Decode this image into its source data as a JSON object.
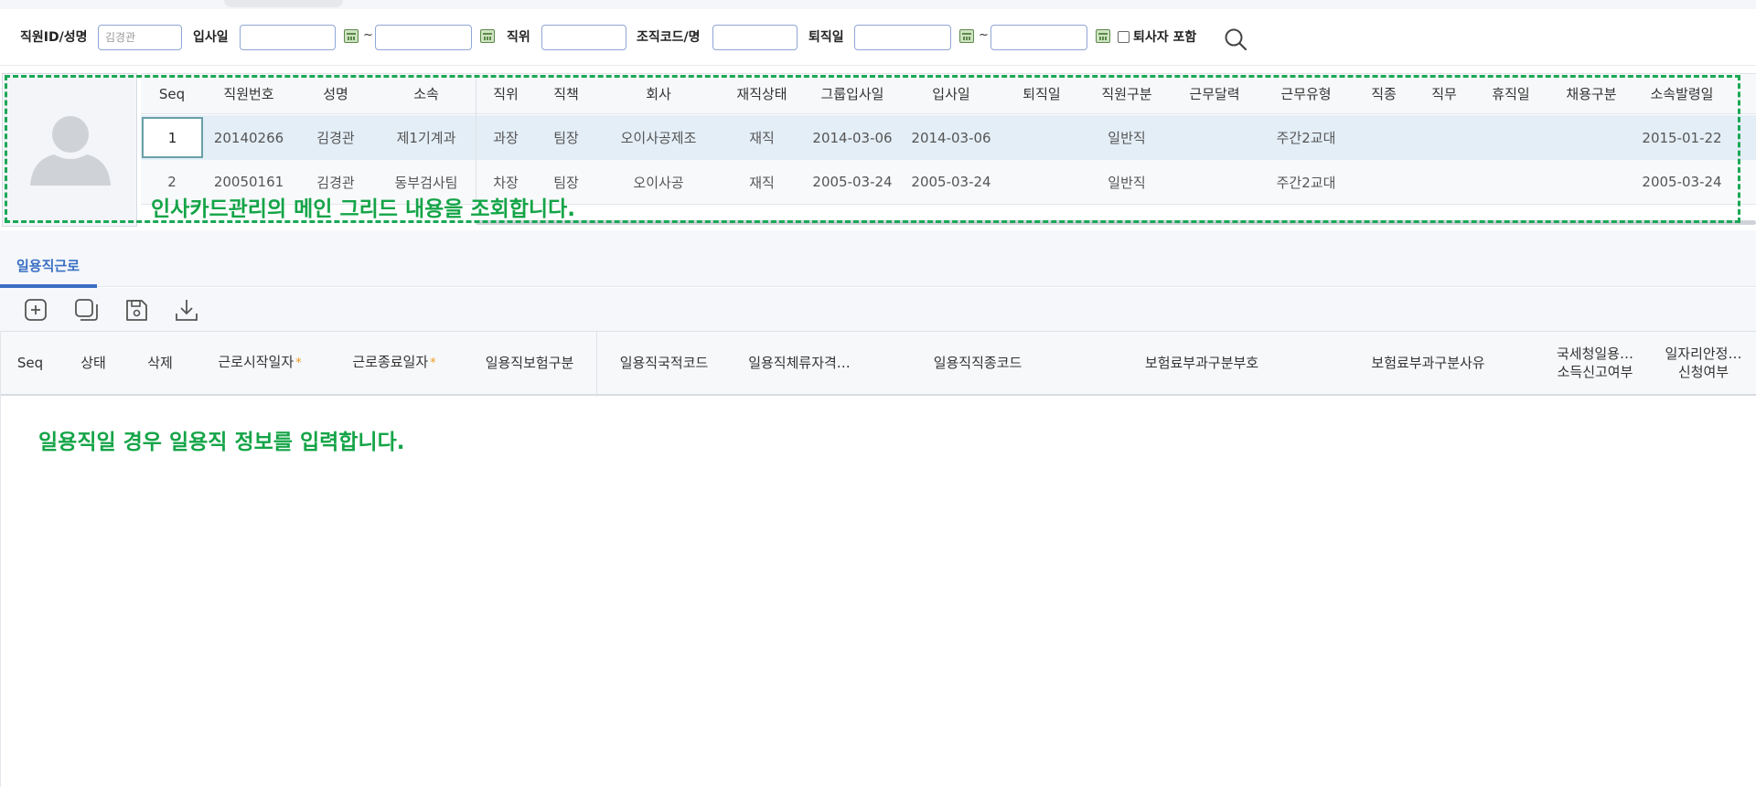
{
  "search": {
    "employee_label": "직원ID/성명",
    "employee_value": "김경관",
    "hire_date_label": "입사일",
    "hire_from_value": "",
    "hire_to_value": "",
    "tilde": "~",
    "position_label": "직위",
    "position_value": "",
    "org_label": "조직코드/명",
    "org_value": "",
    "retire_label": "퇴직일",
    "retire_from_value": "",
    "retire_to_value": "",
    "include_retired_label": "퇴사자 포함",
    "include_retired_checked": false
  },
  "main_grid": {
    "columns": [
      "Seq",
      "직원번호",
      "성명",
      "소속",
      "직위",
      "직책",
      "회사",
      "재직상태",
      "그룹입사일",
      "입사일",
      "퇴직일",
      "직원구분",
      "근무달력",
      "근무유형",
      "직종",
      "직무",
      "휴직일",
      "채용구분",
      "소속발령일"
    ],
    "rows": [
      [
        "1",
        "20140266",
        "김경관",
        "제1기계과",
        "과장",
        "팀장",
        "오이사공제조",
        "재직",
        "2014-03-06",
        "2014-03-06",
        "",
        "일반직",
        "",
        "주간2교대",
        "",
        "",
        "",
        "",
        "2015-01-22"
      ],
      [
        "2",
        "20050161",
        "김경관",
        "동부검사팀",
        "차장",
        "팀장",
        "오이사공",
        "재직",
        "2005-03-24",
        "2005-03-24",
        "",
        "일반직",
        "",
        "주간2교대",
        "",
        "",
        "",
        "",
        "2005-03-24"
      ]
    ],
    "selected_row": 0
  },
  "annotation_main": "인사카드관리의 메인 그리드 내용을 조회합니다.",
  "tab": {
    "label": "일용직근로"
  },
  "toolbar": {
    "icons": [
      "add-icon",
      "copy-icon",
      "save-icon",
      "download-icon"
    ]
  },
  "sub_grid": {
    "columns": [
      "Seq",
      "상태",
      "삭제",
      "근로시작일자",
      "근로종료일자",
      "일용직보험구분",
      "일용직국적코드",
      "일용직체류자격…",
      "일용직직종코드",
      "보험료부과구분부호",
      "보험료부과구분사유",
      "국세청일용…",
      "소득신고여부",
      "일자리안정…",
      "신청여부"
    ],
    "required_mark": "*"
  },
  "annotation_sub": "일용직일 경우 일용직 정보를 입력합니다.",
  "colors": {
    "accent": "#3a6fc4",
    "annotation": "#14a447",
    "selected_row": "#e4eef7",
    "required": "#f09a1a"
  }
}
